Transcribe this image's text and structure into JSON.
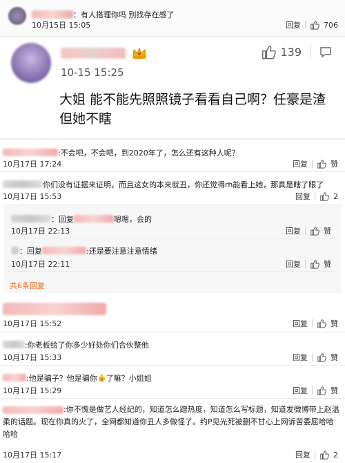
{
  "top_comment": {
    "text": "：有人搭理你吗 别找存在感了",
    "time": "10月15日 15:05",
    "reply_label": "回复",
    "likes": "706"
  },
  "featured": {
    "time": "10-15 15:25",
    "likes": "139",
    "text": "大姐 能不能先照照镜子看看自己啊？任豪是渣但她不瞎"
  },
  "comments": [
    {
      "text": ":不会吧，不会吧，到2020年了，怎么还有这种人呢？",
      "time": "10月17日 17:24",
      "reply": "回复",
      "like": "赞"
    },
    {
      "text": "你们没有证据来证明，而且这女的本来就丑，你还觉得rh能看上她，那真是瞎了眼了",
      "time": "10月17日 15:53",
      "reply": "回复",
      "like": "2"
    }
  ],
  "replies": [
    {
      "prefix": "：回复",
      "suffix": "嗯嗯，会的",
      "time": "10月17日 22:13",
      "reply": "回复",
      "like": "赞"
    },
    {
      "prefix": "：回复",
      "suffix": ":还是要注意注意情绪",
      "time": "10月17日 22:11",
      "reply": "回复",
      "like": "赞"
    }
  ],
  "more_replies": "共6条回复",
  "comments2": [
    {
      "time": "10月17日 15:52",
      "reply": "回复",
      "like": "赞"
    },
    {
      "text": ":你老板给了你多少好处你们合伙整他",
      "time": "10月17日 15:33",
      "reply": "回复",
      "like": "赞"
    },
    {
      "text": ":他是骗子？他是骗你",
      "text2": "了嘛？小姐姐",
      "time": "10月17日 15:29",
      "reply": "回复",
      "like": "赞"
    },
    {
      "text": ":你不愧是做艺人经纪的，知道怎么蹭热度，知道怎么写标题，知道发微博带上赵温柔的话题。现在你真的火了，全网都知道你丑人多做怪了。约P见光死被删不甘心上网诉苦委屈哈哈哈哈",
      "time": "10月17日 15:17",
      "reply": "回复",
      "like": "2"
    }
  ],
  "colors": {
    "link": "#e86a22",
    "crown": "#f0b400",
    "muted": "#333333"
  }
}
